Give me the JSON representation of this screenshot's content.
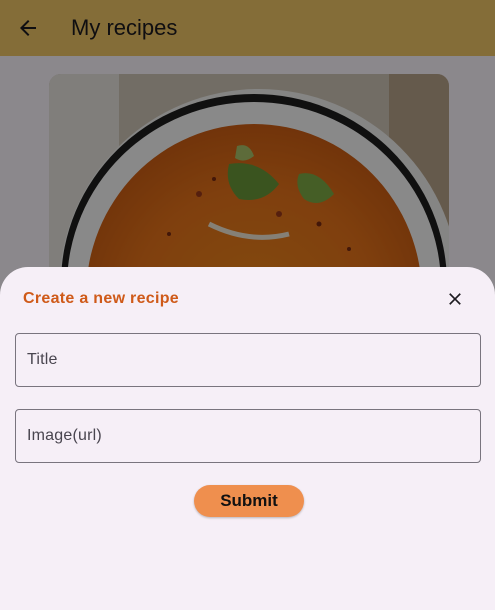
{
  "app_bar": {
    "title": "My recipes",
    "back_icon": "arrow-back-icon",
    "background": "#f0c666"
  },
  "recipe_card": {
    "image_subject": "pumpkin soup with basil"
  },
  "sheet": {
    "title": "Create a new recipe",
    "close_icon": "close-icon",
    "title_field": {
      "placeholder": "Title",
      "value": ""
    },
    "image_field": {
      "placeholder": "Image(url)",
      "value": ""
    },
    "submit_label": "Submit",
    "accent_color": "#cf5a19",
    "button_color": "#ef8f4e"
  }
}
